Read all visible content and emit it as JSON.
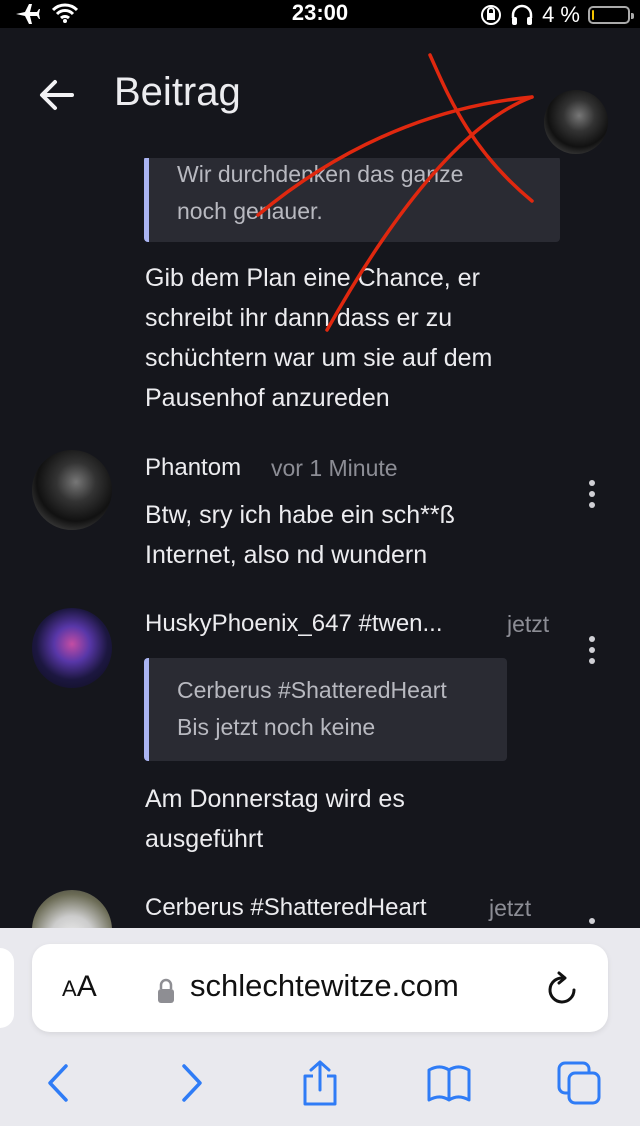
{
  "status_bar": {
    "time": "23:00",
    "battery": "4 %",
    "battery_level": 0.04
  },
  "header": {
    "title": "Beitrag"
  },
  "posts": [
    {
      "quote_lines": [
        "Wir durchdenken das ganze",
        "noch genauer."
      ],
      "message_lines": [
        "Gib dem Plan eine Chance, er",
        "schreibt ihr dann dass er zu",
        "schüchtern war um sie auf dem",
        "Pausenhof anzureden"
      ]
    },
    {
      "author": "Phantom",
      "time": "vor 1 Minute",
      "message_lines": [
        "Btw, sry ich habe ein sch**ß",
        "Internet, also nd wundern"
      ]
    },
    {
      "author": "HuskyPhoenix_647 #twen...",
      "time": "jetzt",
      "quote_author": "Cerberus #ShatteredHeart",
      "quote_text": "Bis jetzt noch keine",
      "message_lines": [
        "Am Donnerstag wird es",
        "ausgeführt"
      ]
    },
    {
      "author": "Cerberus #ShatteredHeart",
      "time": "jetzt"
    }
  ],
  "browser": {
    "aa_label_small": "A",
    "aa_label_large": "A",
    "url": "schlechtewitze.com"
  },
  "colors": {
    "accent_blue": "#2f7cf6",
    "quote_border": "#aab4f2",
    "annotation_red": "#e0280f"
  }
}
